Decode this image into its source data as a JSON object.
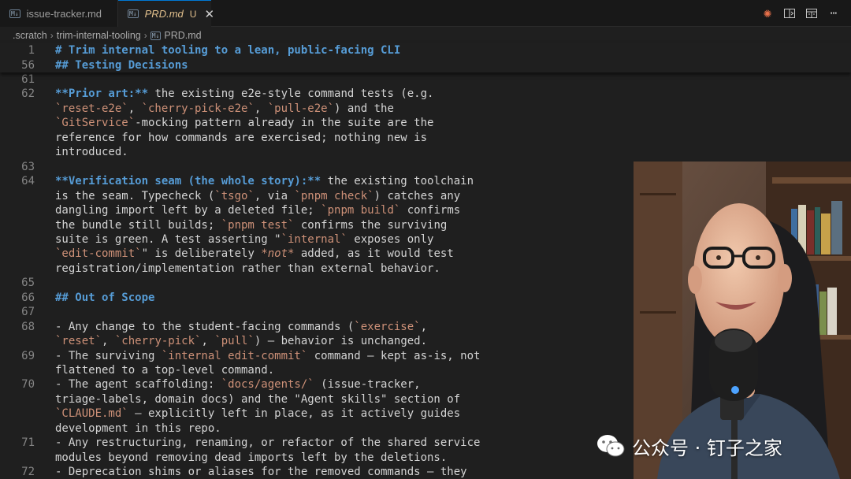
{
  "tabs": [
    {
      "icon": "M↓",
      "title": "issue-tracker.md"
    },
    {
      "icon": "M↓",
      "title": "PRD.md",
      "status": "U",
      "close": "✕"
    }
  ],
  "breadcrumb": {
    "items": [
      ".scratch",
      "trim-internal-tooling"
    ],
    "file_icon": "M↓",
    "file": "PRD.md",
    "separator": "›"
  },
  "editor": {
    "sticky": [
      {
        "ln": "1",
        "segs": [
          {
            "t": "# Trim internal tooling to a lean, public-facing CLI",
            "k": "h"
          }
        ]
      },
      {
        "ln": "56",
        "segs": [
          {
            "t": "## Testing Decisions",
            "k": "h"
          }
        ]
      }
    ],
    "lines": [
      {
        "ln": "61",
        "segs": []
      },
      {
        "ln": "62",
        "segs": [
          {
            "t": "**Prior art:**",
            "k": "b"
          },
          {
            "t": " the existing e2e-style command tests (e.g.",
            "k": ""
          }
        ]
      },
      {
        "ln": "",
        "segs": [
          {
            "t": "`reset-e2e`",
            "k": "c"
          },
          {
            "t": ", ",
            "k": ""
          },
          {
            "t": "`cherry-pick-e2e`",
            "k": "c"
          },
          {
            "t": ", ",
            "k": ""
          },
          {
            "t": "`pull-e2e`",
            "k": "c"
          },
          {
            "t": ") and the",
            "k": ""
          }
        ]
      },
      {
        "ln": "",
        "segs": [
          {
            "t": "`GitService`",
            "k": "c"
          },
          {
            "t": "-mocking pattern already in the suite are the",
            "k": ""
          }
        ]
      },
      {
        "ln": "",
        "segs": [
          {
            "t": "reference for how commands are exercised; nothing new is",
            "k": ""
          }
        ]
      },
      {
        "ln": "",
        "segs": [
          {
            "t": "introduced.",
            "k": ""
          }
        ]
      },
      {
        "ln": "63",
        "segs": []
      },
      {
        "ln": "64",
        "segs": [
          {
            "t": "**Verification seam (the whole story):**",
            "k": "b"
          },
          {
            "t": " the existing toolchain",
            "k": ""
          }
        ]
      },
      {
        "ln": "",
        "segs": [
          {
            "t": "is the seam. Typecheck (",
            "k": ""
          },
          {
            "t": "`tsgo`",
            "k": "c"
          },
          {
            "t": ", via ",
            "k": ""
          },
          {
            "t": "`pnpm check`",
            "k": "c"
          },
          {
            "t": ") catches any",
            "k": ""
          }
        ]
      },
      {
        "ln": "",
        "segs": [
          {
            "t": "dangling import left by a deleted file; ",
            "k": ""
          },
          {
            "t": "`pnpm build`",
            "k": "c"
          },
          {
            "t": " confirms",
            "k": ""
          }
        ]
      },
      {
        "ln": "",
        "segs": [
          {
            "t": "the bundle still builds; ",
            "k": ""
          },
          {
            "t": "`pnpm test`",
            "k": "c"
          },
          {
            "t": " confirms the surviving",
            "k": ""
          }
        ]
      },
      {
        "ln": "",
        "segs": [
          {
            "t": "suite is green. A test asserting \"",
            "k": ""
          },
          {
            "t": "`internal`",
            "k": "c"
          },
          {
            "t": " exposes only",
            "k": ""
          }
        ]
      },
      {
        "ln": "",
        "segs": [
          {
            "t": "`edit-commit`",
            "k": "c"
          },
          {
            "t": "\" is deliberately ",
            "k": ""
          },
          {
            "t": "*not*",
            "k": "i"
          },
          {
            "t": " added, as it would test",
            "k": ""
          }
        ]
      },
      {
        "ln": "",
        "segs": [
          {
            "t": "registration/implementation rather than external behavior.",
            "k": ""
          }
        ]
      },
      {
        "ln": "65",
        "segs": []
      },
      {
        "ln": "66",
        "segs": [
          {
            "t": "## Out of Scope",
            "k": "h"
          }
        ]
      },
      {
        "ln": "67",
        "segs": []
      },
      {
        "ln": "68",
        "segs": [
          {
            "t": "- Any change to the student-facing commands (",
            "k": ""
          },
          {
            "t": "`exercise`",
            "k": "c"
          },
          {
            "t": ",",
            "k": ""
          }
        ]
      },
      {
        "ln": "",
        "segs": [
          {
            "t": "`reset`",
            "k": "c"
          },
          {
            "t": ", ",
            "k": ""
          },
          {
            "t": "`cherry-pick`",
            "k": "c"
          },
          {
            "t": ", ",
            "k": ""
          },
          {
            "t": "`pull`",
            "k": "c"
          },
          {
            "t": ") — behavior is unchanged.",
            "k": ""
          }
        ]
      },
      {
        "ln": "69",
        "segs": [
          {
            "t": "- The surviving ",
            "k": ""
          },
          {
            "t": "`internal edit-commit`",
            "k": "c"
          },
          {
            "t": " command — kept as-is, not",
            "k": ""
          }
        ]
      },
      {
        "ln": "",
        "segs": [
          {
            "t": "flattened to a top-level command.",
            "k": ""
          }
        ]
      },
      {
        "ln": "70",
        "segs": [
          {
            "t": "- The agent scaffolding: ",
            "k": ""
          },
          {
            "t": "`docs/agents/`",
            "k": "c"
          },
          {
            "t": " (issue-tracker,",
            "k": ""
          }
        ]
      },
      {
        "ln": "",
        "segs": [
          {
            "t": "triage-labels, domain docs) and the \"Agent skills\" section of",
            "k": ""
          }
        ]
      },
      {
        "ln": "",
        "segs": [
          {
            "t": "`CLAUDE.md`",
            "k": "c"
          },
          {
            "t": " — explicitly left in place, as it actively guides",
            "k": ""
          }
        ]
      },
      {
        "ln": "",
        "segs": [
          {
            "t": "development in this repo.",
            "k": ""
          }
        ]
      },
      {
        "ln": "71",
        "segs": [
          {
            "t": "- Any restructuring, renaming, or refactor of the shared service",
            "k": ""
          }
        ]
      },
      {
        "ln": "",
        "segs": [
          {
            "t": "modules beyond removing dead imports left by the deletions.",
            "k": ""
          }
        ]
      },
      {
        "ln": "72",
        "segs": [
          {
            "t": "- Deprecation shims or aliases for the removed commands — they",
            "k": ""
          }
        ]
      }
    ]
  },
  "watermark": {
    "text": "公众号 · 钉子之家"
  },
  "colors": {
    "heading": "#569cd6",
    "code": "#ce9178",
    "modified": "#e2c08d",
    "accent": "#0078d4"
  }
}
